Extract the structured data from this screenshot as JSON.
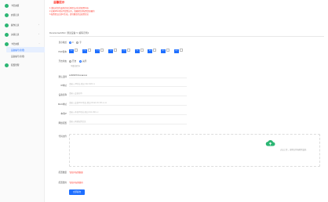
{
  "colors": {
    "accent": "#1e6fff",
    "brand_green": "#2bb673",
    "warning": "#ff3b30"
  },
  "sidebar": {
    "items": [
      {
        "label": "卡密充值",
        "icon": "circle-icon"
      },
      {
        "label": "充值记录",
        "icon": "circle-icon"
      },
      {
        "label": "操作记录",
        "icon": "circle-icon"
      },
      {
        "label": "关联记录",
        "icon": "circle-icon"
      },
      {
        "label": "卡密充值",
        "icon": "circle-icon"
      },
      {
        "label": "配置管理",
        "icon": "circle-icon"
      }
    ],
    "subitems": [
      {
        "label": "设备编号(新增)"
      },
      {
        "label": "设备编号(新增)"
      }
    ],
    "caret": "›"
  },
  "notice": {
    "title": "温馨提示",
    "lines": [
      "1.请核对您的设备信息后再提交对应的配置内容",
      "2.如果MAC地址不是默认的，请确保您的配置是准确的",
      "3.配置提交后即可生效，请勿重复提交配置信息"
    ]
  },
  "crumb": "DeviceUserMAC: 测试设备 V: 编码示例1",
  "form": {
    "os_row": {
      "label": "显示格式",
      "opt1": "0",
      "opt2": "字"
    },
    "tags_row": {
      "label": "PHP版本",
      "tags": [
        "5.6",
        "7.0",
        "7.1",
        "7.2",
        "7.3",
        "7.4",
        "8.0",
        "8.1",
        "8.2"
      ]
    },
    "toggle_row": {
      "label": "开启状态",
      "opt1": "开启",
      "opt2": "关闭",
      "hint": "不填关闭为0"
    },
    "fields": [
      {
        "label": "默认选择",
        "value": "12345678  Domainxxx",
        "filled": true
      },
      {
        "label": "IP地址",
        "value": "请输入IP地址,例如:192.168.0.1",
        "filled": false
      },
      {
        "label": "设备名称",
        "value": "请输入设备名称",
        "filled": false
      },
      {
        "label": "MAC地址",
        "value": "请输入设备MAC地址,例如:00-E0-4C-68-xx-xx",
        "filled": false
      },
      {
        "label": "本机IP",
        "value": "请输入本机IP地址,例如:192.168.x.x",
        "filled": false
      },
      {
        "label": "网络配置",
        "value": "请输入网络配置信息",
        "filled": false
      }
    ],
    "upload": {
      "label": "代码文件",
      "hint": "点击上传，或将文件拖拽到此处"
    },
    "req1": {
      "label": "配置数量",
      "value": "*请填写配置数量"
    },
    "req2": {
      "label": "配置费用",
      "value": "*请填写配置费用"
    },
    "submit": "立即提交"
  }
}
